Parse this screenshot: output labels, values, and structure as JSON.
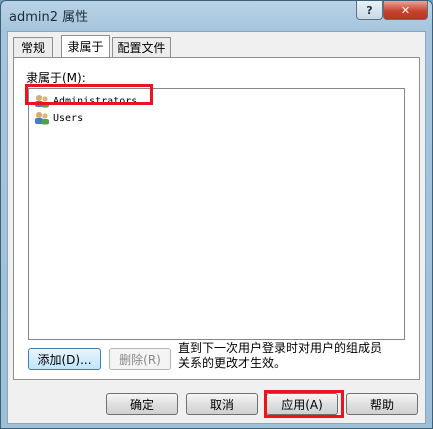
{
  "window": {
    "title": "admin2 属性",
    "help_glyph": "?",
    "close_glyph": "✕"
  },
  "tabs": [
    {
      "label": "常规",
      "active": false
    },
    {
      "label": "隶属于",
      "active": true
    },
    {
      "label": "配置文件",
      "active": false
    }
  ],
  "member_of": {
    "label": "隶属于(M):",
    "items": [
      {
        "name": "Administrators",
        "icon": "group-icon",
        "highlighted": true
      },
      {
        "name": "Users",
        "icon": "group-icon",
        "highlighted": false
      }
    ]
  },
  "actions": {
    "add_label": "添加(D)...",
    "remove_label": "删除(R)"
  },
  "note": "直到下一次用户登录时对用户的组成员关系的更改才生效。",
  "footer": {
    "ok_label": "确定",
    "cancel_label": "取消",
    "apply_label": "应用(A)",
    "help_label": "帮助"
  },
  "colors": {
    "highlight_border": "#e8141e",
    "close_button": "#c7442f"
  }
}
